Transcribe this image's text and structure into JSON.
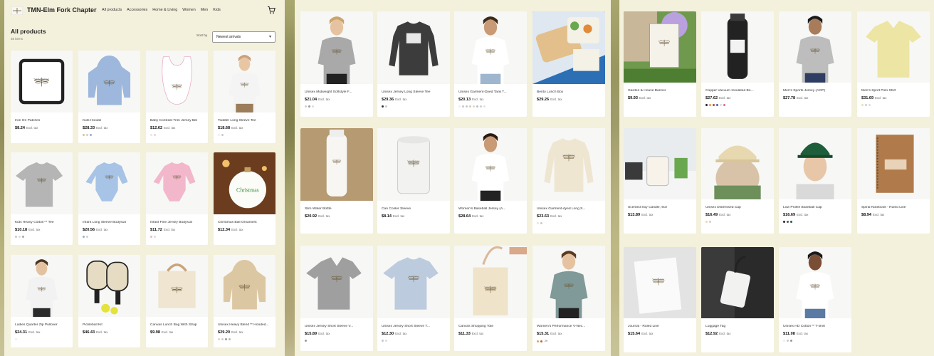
{
  "store": {
    "name": "TMN-Elm Fork Chapter",
    "nav": [
      "All products",
      "Accessories",
      "Home & Living",
      "Women",
      "Men",
      "Kids"
    ]
  },
  "listing": {
    "title": "All products",
    "count": "35 items",
    "sort_label": "Sort by",
    "sort_value": "Newest arrivals",
    "tax_note": "Excl. tax"
  },
  "colors": {
    "panel": "#f3f0dc",
    "card": "#ffffff",
    "image_bg": "#f7f7f5"
  },
  "products": [
    {
      "name": "Iron On Patches",
      "price": "$8.24",
      "img": "patch",
      "dots": []
    },
    {
      "name": "Kids Hoodie",
      "price": "$28.33",
      "img": "hoodie-blue",
      "dots": [
        "#e0c090",
        "#cfcfcf",
        "#8fb0d6"
      ]
    },
    {
      "name": "Baby Contrast Trim Jersey Bib",
      "price": "$12.62",
      "img": "bib",
      "dots": [
        "#e7e7e7",
        "#eccfd8"
      ]
    },
    {
      "name": "Toddler Long Sleeve Tee",
      "price": "$18.68",
      "img": "toddler",
      "dots": [
        "#eeeeee",
        "#c9c9c9"
      ]
    },
    {
      "name": "Kids Heavy Cotton™ Tee",
      "price": "$10.18",
      "img": "tee-gray",
      "dots": [
        "#c9c9c9",
        "#dddddd",
        "#aaaaaa"
      ]
    },
    {
      "name": "Infant Long Sleeve Bodysuit",
      "price": "$20.56",
      "img": "bodysuit-blue",
      "dots": [
        "#8fb0d6",
        "#cfcfcf"
      ]
    },
    {
      "name": "Infant Fine Jersey Bodysuit",
      "price": "$11.72",
      "img": "bodysuit-pink",
      "dots": [
        "#eeb6c8",
        "#dddddd"
      ]
    },
    {
      "name": "Christmas Ball Ornament",
      "price": "$12.34",
      "img": "ornament",
      "dots": []
    },
    {
      "name": "Ladies Quarter Zip Pullover",
      "price": "$24.31",
      "img": "pullover",
      "dots": [
        "#f0f0f0"
      ]
    },
    {
      "name": "Pickleball Kit",
      "price": "$46.43",
      "img": "pickleball",
      "dots": []
    },
    {
      "name": "Canvas Lunch Bag With Strap",
      "price": "$9.98",
      "img": "lunchbag",
      "dots": []
    },
    {
      "name": "Unisex Heavy Blend™ Hooded...",
      "price": "$29.20",
      "img": "hoodie-sand",
      "dots": [
        "#e2d3b6",
        "#cfcfcf",
        "#9a9a9a",
        "#c8b59a"
      ]
    },
    {
      "name": "Unisex Midweight Softstyle F...",
      "price": "$21.04",
      "img": "woman-sweat",
      "dots": [
        "#cfcfcf",
        "#9a9a9a",
        "#dddddd"
      ]
    },
    {
      "name": "Unisex Jersey Long Sleeve Tee",
      "price": "$29.36",
      "img": "ls-dark",
      "dots": [
        "#333333",
        "#c9c9c9"
      ]
    },
    {
      "name": "Unisex Garment-Dyed Tank T...",
      "price": "$20.13",
      "img": "tank",
      "dots": [
        "#eeeeee",
        "#c9c9c9",
        "#b5d1c4",
        "#e4c9b0",
        "#d8d8d8",
        "#bfbfbf",
        "#cfcfcf",
        "#e2e2e2"
      ]
    },
    {
      "name": "Bento Lunch Box",
      "price": "$29.26",
      "img": "bento",
      "dots": []
    },
    {
      "name": "Slim Water Bottle",
      "price": "$20.92",
      "img": "bottle",
      "dots": []
    },
    {
      "name": "Can Cooler Sleeve",
      "price": "$8.14",
      "img": "cooler",
      "dots": []
    },
    {
      "name": "Women's Baseball Jersey (A...",
      "price": "$28.64",
      "img": "baseball",
      "dots": []
    },
    {
      "name": "Unisex Garment-dyed Long S...",
      "price": "$23.63",
      "img": "ls-cream",
      "dots": [
        "#efe6d2",
        "#c9c9c9"
      ]
    },
    {
      "name": "Unisex Jersey Short Sleeve V...",
      "price": "$15.89",
      "img": "vneck-gray",
      "dots": [
        "#9a9a9a"
      ]
    },
    {
      "name": "Unisex Jersey Short Sleeve T...",
      "price": "$12.30",
      "img": "tee-blue",
      "dots": [
        "#b9c9dc",
        "#dddddd"
      ]
    },
    {
      "name": "Canvas Shopping Tote",
      "price": "$11.33",
      "img": "tote",
      "dots": []
    },
    {
      "name": "Women's Performance V-Nec...",
      "price": "$15.31",
      "img": "perf-vneck",
      "dots": [
        "#c8b34a",
        "#d05a3a"
      ],
      "more": "29"
    },
    {
      "name": "Garden & House Banner",
      "price": "$9.93",
      "img": "banner",
      "dots": []
    },
    {
      "name": "Copper Vacuum Insulated Bo...",
      "price": "$27.62",
      "img": "vacuum",
      "dots": [
        "#222222",
        "#d6a23a",
        "#c43c3c",
        "#3a64b5",
        "#dddddd",
        "#e06a8a"
      ]
    },
    {
      "name": "Men's Sports Jersey (AOP)",
      "price": "$27.78",
      "img": "sports-jersey",
      "dots": []
    },
    {
      "name": "Men's Sport Polo Shirt",
      "price": "$31.69",
      "img": "polo",
      "dots": [
        "#e8e4a8",
        "#cfcfcf",
        "#dddddd"
      ]
    },
    {
      "name": "Scented Soy Candle, 9oz",
      "price": "$13.89",
      "img": "candle",
      "dots": []
    },
    {
      "name": "Unisex Distressed Cap",
      "price": "$16.49",
      "img": "cap-beige",
      "dots": [
        "#e8d8b0",
        "#cfcfcf"
      ]
    },
    {
      "name": "Low Profile Baseball Cap",
      "price": "$16.69",
      "img": "cap-green",
      "dots": [
        "#222222",
        "#555555",
        "#1e5e3a"
      ]
    },
    {
      "name": "Spiral Notebook - Ruled Line",
      "price": "$8.94",
      "img": "notebook",
      "dots": []
    },
    {
      "name": "Journal - Ruled Line",
      "price": "$15.64",
      "img": "journal",
      "dots": []
    },
    {
      "name": "Luggage Tag",
      "price": "$12.92",
      "img": "luggage",
      "dots": []
    },
    {
      "name": "Unisex HD Cotton™ T-shirt",
      "price": "$11.08",
      "img": "hd-tee",
      "dots": [
        "#eeeeee",
        "#c9c9c9",
        "#9a9a9a"
      ]
    }
  ]
}
